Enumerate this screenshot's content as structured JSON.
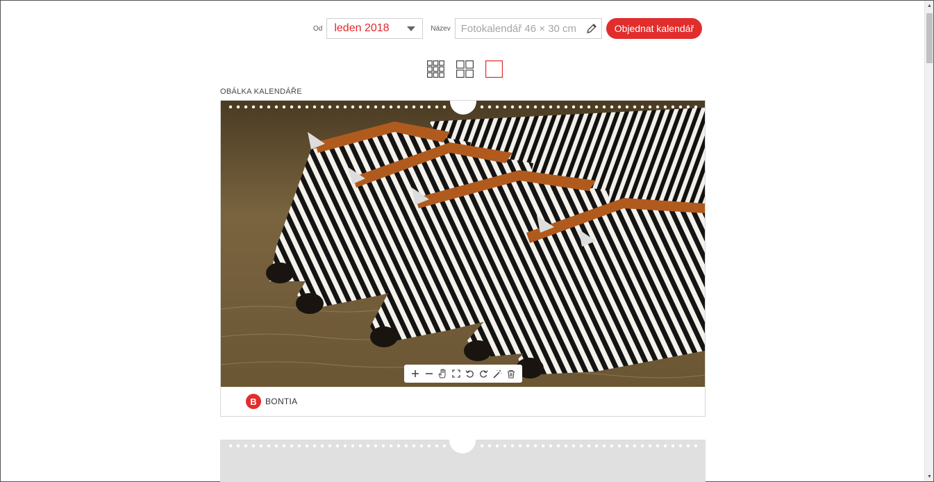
{
  "toolbar": {
    "from_label": "Od",
    "from_value": "leden 2018",
    "name_label": "Název",
    "name_placeholder": "Fotokalendář 46 × 30 cm",
    "order_button": "Objednat kalendář"
  },
  "views": [
    {
      "icon": "grid-9-icon",
      "active": false
    },
    {
      "icon": "grid-4-icon",
      "active": false
    },
    {
      "icon": "single-page-icon",
      "active": true
    }
  ],
  "cover": {
    "section_label": "OBÁLKA KALENDÁŘE",
    "brand_name": "BONTIA",
    "brand_logo_letter": "B"
  },
  "photo_tools": [
    "zoom-in-icon",
    "zoom-out-icon",
    "pan-hand-icon",
    "fit-frame-icon",
    "rotate-left-icon",
    "rotate-right-icon",
    "magic-wand-icon",
    "trash-icon"
  ],
  "colors": {
    "accent": "#e22d2d",
    "select_text": "#e0262c",
    "placeholder": "#a5a5a5",
    "border": "#cfcfcf"
  }
}
